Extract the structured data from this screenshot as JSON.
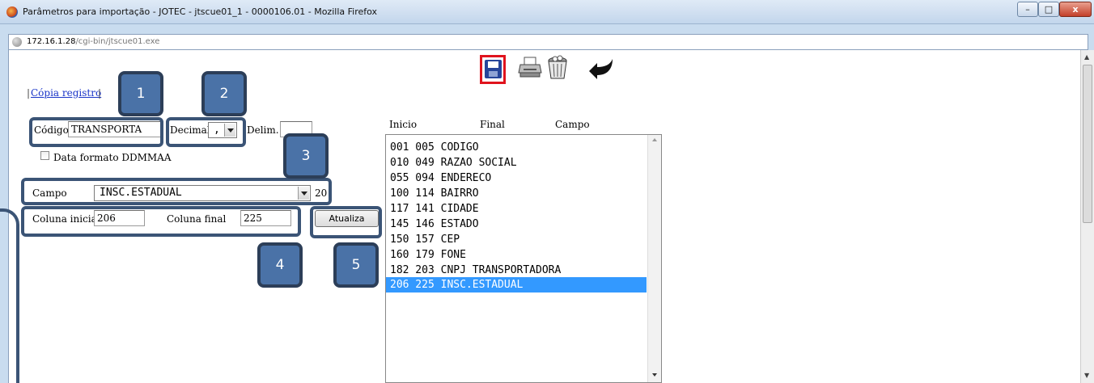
{
  "window": {
    "title": "Parâmetros para importação - JOTEC - jtscue01_1 - 0000106.01 - Mozilla Firefox",
    "controls": {
      "minimize": "–",
      "maximize": "□",
      "close": "x"
    }
  },
  "address": {
    "host": "172.16.1.28",
    "path": "/cgi-bin/jtscue01.exe"
  },
  "toolbar": {
    "icons": [
      "save-icon",
      "print-icon",
      "trash-icon",
      "back-icon"
    ]
  },
  "form": {
    "copy_link": "Cópia registro",
    "pipe": "|",
    "codigo_label": "Código",
    "codigo_value": "TRANSPORTA",
    "decimal_label": "Decimal",
    "decimal_value": ",",
    "delim_label": "Delim.",
    "delim_value": "",
    "date_format_label": "Data formato DDMMAA",
    "campo_label": "Campo",
    "campo_value": "INSC.ESTADUAL",
    "campo_size": "20",
    "coluna_inicial_label": "Coluna inicial",
    "coluna_inicial_value": "206",
    "coluna_final_label": "Coluna final",
    "coluna_final_value": "225",
    "update_button": "Atualiza"
  },
  "list": {
    "headers": {
      "inicio": "Inicio",
      "final": "Final",
      "campo": "Campo"
    },
    "rows": [
      "001 005 CODIGO",
      "010 049 RAZAO SOCIAL",
      "055 094 ENDERECO",
      "100 114 BAIRRO",
      "117 141 CIDADE",
      "145 146 ESTADO",
      "150 157 CEP",
      "160 179 FONE",
      "182 203 CNPJ TRANSPORTADORA",
      "206 225 INSC.ESTADUAL"
    ],
    "selected_index": 9
  },
  "callouts": [
    "1",
    "2",
    "3",
    "4",
    "5"
  ],
  "colors": {
    "highlight_red": "#e0131d",
    "selection_blue": "#3399ff",
    "callout_blue": "#4a72a7"
  }
}
